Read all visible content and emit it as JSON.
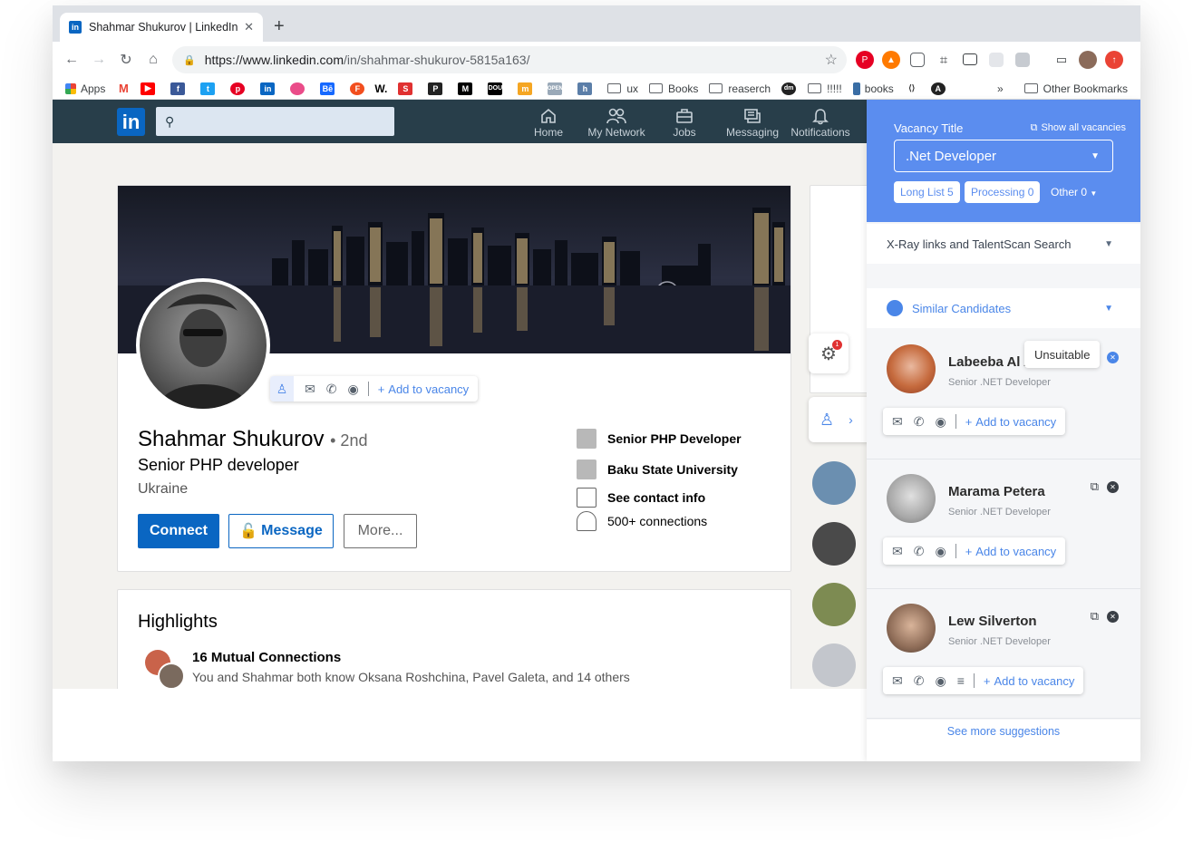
{
  "browser": {
    "tab_title": "Shahmar Shukurov | LinkedIn",
    "url_host": "https://www.linkedin.com",
    "url_path": "/in/shahmar-shukurov-5815a163/",
    "bookmarks": [
      "Apps",
      "W.",
      "ux",
      "Books",
      "reaserch",
      "!!!!!",
      "books"
    ],
    "overflow": "»",
    "other_bookmarks": "Other Bookmarks"
  },
  "linkedin": {
    "logo": "in",
    "nav": [
      "Home",
      "My Network",
      "Jobs",
      "Messaging",
      "Notifications"
    ]
  },
  "profile": {
    "name": "Shahmar Shukurov",
    "degree": "• 2nd",
    "headline": "Senior PHP developer",
    "location": "Ukraine",
    "connect": "Connect",
    "message": "Message",
    "more": "More...",
    "info": [
      "Senior PHP Developer",
      "Baku State University",
      "See contact info",
      "500+ connections"
    ],
    "add_to_vacancy": "Add to vacancy"
  },
  "highlights": {
    "title": "Highlights",
    "heading": "16 Mutual Connections",
    "text": "You and Shahmar both know Oksana Roshchina, Pavel Galeta, and 14 others"
  },
  "extension": {
    "vacancy_label": "Vacancy Title",
    "show_all": "Show all vacancies",
    "vacancy_value": ".Net Developer",
    "pills": [
      "Long List  5",
      "Processing  0"
    ],
    "other": "Other  0",
    "xray": "X-Ray links and TalentScan Search",
    "similar": "Similar Candidates",
    "unsuitable": "Unsuitable",
    "add_to_vacancy": "Add to vacancy",
    "see_more": "See more suggestions",
    "badge": "1",
    "candidates": [
      {
        "name": "Labeeba Al A",
        "title": "Senior .NET Developer"
      },
      {
        "name": "Marama Petera",
        "title": "Senior .NET Developer"
      },
      {
        "name": "Lew Silverton",
        "title": "Senior .NET Developer"
      }
    ]
  },
  "colors": {
    "linkedin_blue": "#0a66c2",
    "ext_blue": "#5b8def",
    "nav_bg": "#283e4a"
  }
}
